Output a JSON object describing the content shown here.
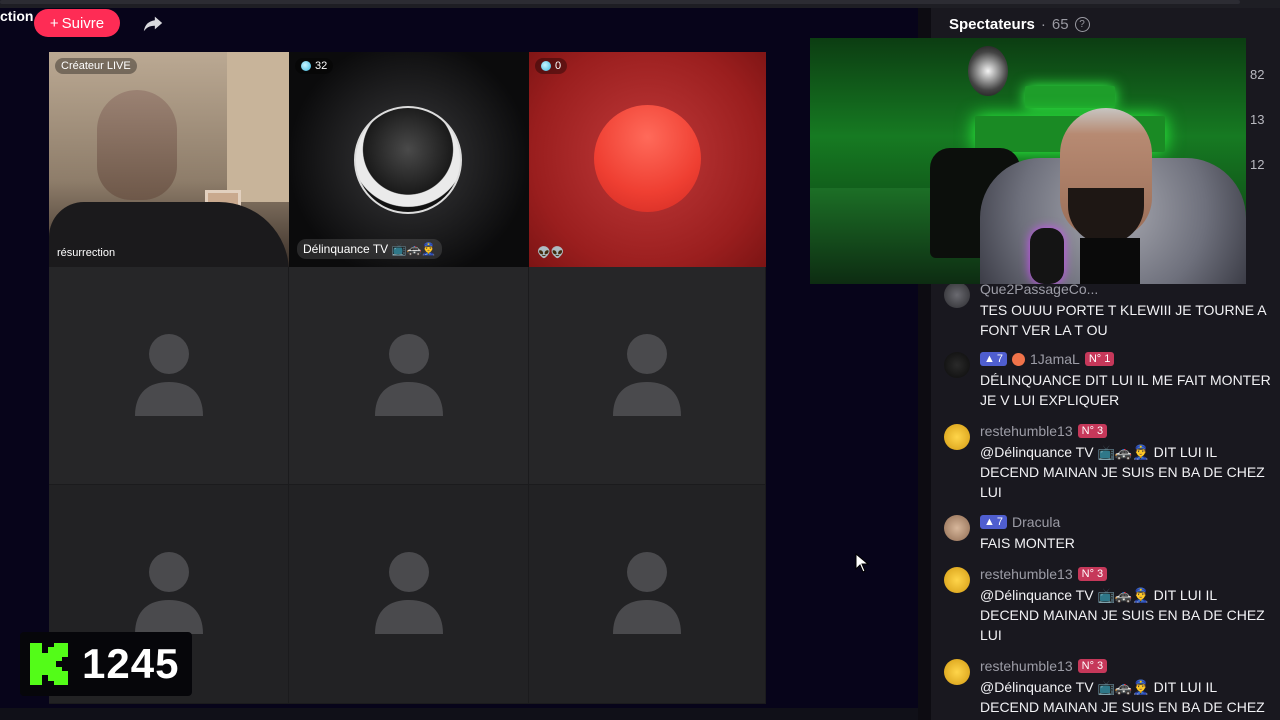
{
  "header": {
    "title_fragment": "ction",
    "follow_label": "Suivre",
    "follow_plus": "+"
  },
  "grid": {
    "tiles": [
      {
        "badge": "Créateur LIVE",
        "name": "résurrection"
      },
      {
        "badge_count": "32",
        "name": "Délinquance TV 📺🚓👮‍♂️"
      },
      {
        "badge_count": "0",
        "name": "👽👽"
      }
    ]
  },
  "kick_overlay": {
    "count": "1245"
  },
  "panel": {
    "title": "Spectateurs",
    "separator": "·",
    "viewer_count": "65",
    "help_glyph": "?",
    "side_numbers": [
      "82",
      "13",
      "12"
    ]
  },
  "chat": {
    "messages": [
      {
        "user": "Que2PassageCo...",
        "text": "TES OUUU PORTE T KLEWIII JE TOURNE A FONT VER LA T OU"
      },
      {
        "level": "7",
        "user": "1JamaL",
        "rank": "N° 1",
        "text": "DÉLINQUANCE DIT LUI IL ME FAIT MONTER JE V LUI EXPLIQUER"
      },
      {
        "user": "restehumble13",
        "rank": "N° 3",
        "text": "@Délinquance TV 📺🚓👮‍♂️ DIT LUI IL DECEND MAINAN JE SUIS EN BA DE CHEZ LUI"
      },
      {
        "level": "7",
        "user": "Dracula",
        "text": "FAIS MONTER"
      },
      {
        "user": "restehumble13",
        "rank": "N° 3",
        "text": "@Délinquance TV 📺🚓👮‍♂️ DIT LUI IL DECEND MAINAN JE SUIS EN BA DE CHEZ LUI"
      },
      {
        "user": "restehumble13",
        "rank": "N° 3",
        "text": "@Délinquance TV 📺🚓👮‍♂️ DIT LUI IL DECEND MAINAN JE SUIS EN BA DE CHEZ LUI"
      }
    ]
  },
  "colors": {
    "follow_button": "#fe2c55",
    "kick_green": "#53fc18",
    "level_badge": "#4f5ecf",
    "rank_badge": "#c6385a"
  },
  "icons": {
    "share": "share-arrow-icon",
    "help": "help-circle-icon",
    "person": "person-placeholder-icon",
    "cursor": "mouse-cursor-icon"
  }
}
